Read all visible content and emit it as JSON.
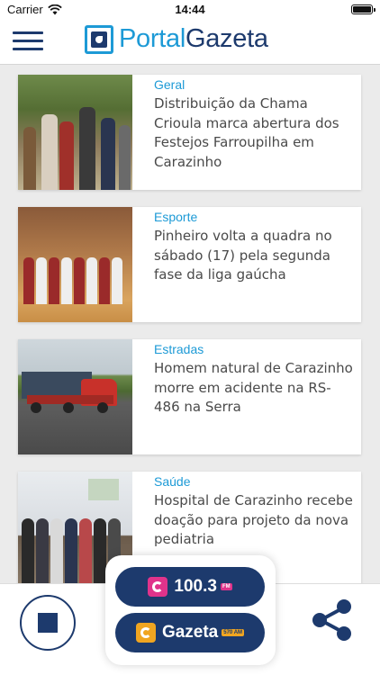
{
  "status_bar": {
    "carrier": "Carrier",
    "time": "14:44"
  },
  "header": {
    "logo_part1": "Portal",
    "logo_part2": "Gazeta"
  },
  "articles": [
    {
      "category": "Geral",
      "title": "Distribuição da Chama Crioula marca abertura dos Festejos Farroupilha em Carazinho"
    },
    {
      "category": "Esporte",
      "title": "Pinheiro volta a quadra no sábado (17) pela segunda fase da liga gaúcha"
    },
    {
      "category": "Estradas",
      "title": "Homem natural de Carazinho morre em acidente na RS-486 na Serra"
    },
    {
      "category": "Saúde",
      "title": "Hospital de Carazinho recebe doação para projeto da nova pediatria"
    }
  ],
  "player": {
    "stations": [
      {
        "label": "100.3",
        "tag": "FM"
      },
      {
        "label": "Gazeta",
        "tag": "570 AM"
      }
    ]
  },
  "colors": {
    "navy": "#1d3a6d",
    "accent": "#1d9ad6",
    "fm_pink": "#e0338b",
    "am_orange": "#f0a521"
  }
}
